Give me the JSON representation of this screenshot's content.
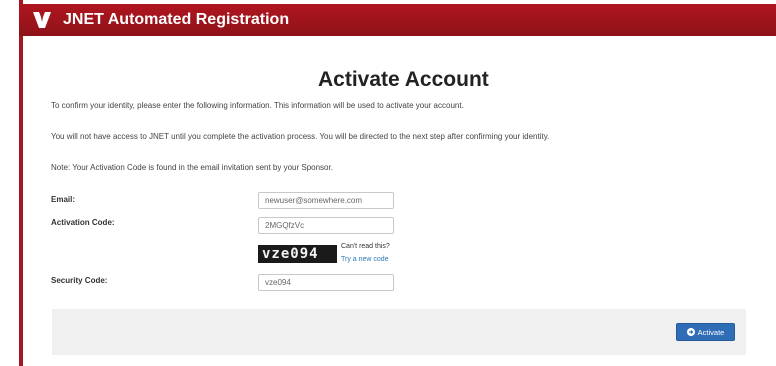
{
  "header": {
    "title": "JNET Automated Registration",
    "logo_icon": "jnet-logo-icon"
  },
  "page": {
    "title": "Activate Account",
    "para1": "To confirm your identity, please enter the following information. This information will be used to activate your account.",
    "para2": "You will not have access to JNET until you complete the activation process. You will be directed to the next step after confirming your identity.",
    "note": "Note: Your Activation Code is found in the email invitation sent by your Sponsor."
  },
  "form": {
    "email_label": "Email:",
    "email_value": "newuser@somewhere.com",
    "activation_label": "Activation Code:",
    "activation_value": "2MGQfzVc",
    "captcha_text": "vze094",
    "cant_read": "Can't read this?",
    "new_code_link": "Try a new code",
    "security_label": "Security Code:",
    "security_value": "vze094"
  },
  "footer": {
    "activate_label": "Activate",
    "activate_icon": "arrow-circle-right-icon"
  },
  "colors": {
    "header_bg": "#a01822",
    "button_bg": "#2f6db6",
    "link": "#2a7ab8",
    "footer_bg": "#f0f0f0"
  }
}
